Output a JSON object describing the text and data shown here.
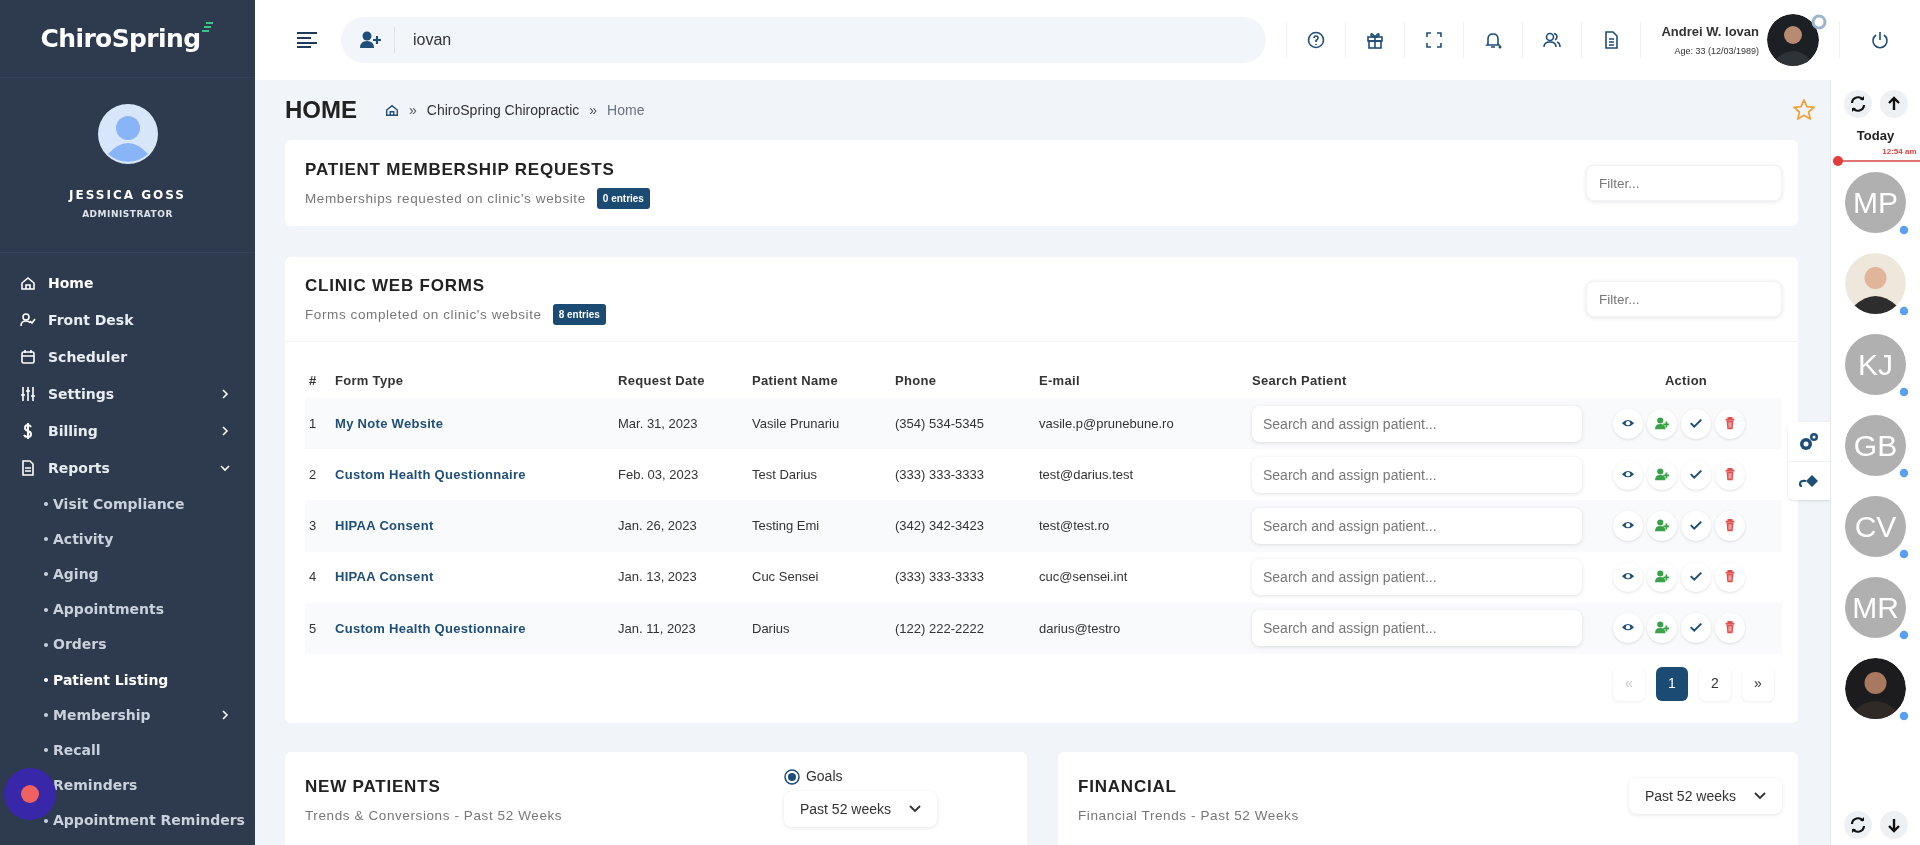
{
  "sidebar": {
    "logo": "ChiroSpring",
    "user": {
      "name": "JESSICA GOSS",
      "role": "ADMINISTRATOR"
    },
    "items": [
      {
        "label": "Home",
        "selected": true
      },
      {
        "label": "Front Desk",
        "selected": false
      },
      {
        "label": "Scheduler",
        "selected": false
      },
      {
        "label": "Settings",
        "selected": false,
        "expanded": false
      },
      {
        "label": "Billing",
        "selected": false,
        "expanded": false
      },
      {
        "label": "Reports",
        "selected": false,
        "expanded": true,
        "children": [
          {
            "label": "Visit Compliance",
            "selected": false
          },
          {
            "label": "Activity",
            "selected": false
          },
          {
            "label": "Aging",
            "selected": false
          },
          {
            "label": "Appointments",
            "selected": false
          },
          {
            "label": "Orders",
            "selected": false
          },
          {
            "label": "Patient Listing",
            "selected": true
          },
          {
            "label": "Membership",
            "selected": false,
            "expanded": false
          },
          {
            "label": "Recall",
            "selected": false
          },
          {
            "label": "Reminders",
            "selected": false
          },
          {
            "label": "Appointment Reminders",
            "selected": false
          }
        ]
      }
    ]
  },
  "topbar": {
    "search": {
      "value": "iovan"
    },
    "user": {
      "name": "Andrei W. Iovan",
      "age": "Age: 33 (12/03/1989)"
    }
  },
  "page": {
    "title": "HOME",
    "breadcrumb": [
      {
        "separator": "»",
        "label": "ChiroSpring Chiropractic"
      },
      {
        "separator": "»",
        "label": "Home"
      }
    ],
    "favorite": false
  },
  "membership_requests": {
    "title": "PATIENT MEMBERSHIP REQUESTS",
    "subtitle": "Memberships requested on clinic's website",
    "badge": "0 entries",
    "filter": {
      "placeholder": "Filter..."
    }
  },
  "web_forms": {
    "title": "CLINIC WEB FORMS",
    "subtitle": "Forms completed on clinic's website",
    "badge": "8 entries",
    "filter": {
      "placeholder": "Filter..."
    },
    "table": {
      "columns": [
        "#",
        "Form Type",
        "Request Date",
        "Patient Name",
        "Phone",
        "E-mail",
        "Search Patient",
        "Action"
      ],
      "rows": [
        {
          "num": "1",
          "form_type": "My Note Website",
          "date": "Mar. 31, 2023",
          "patient": "Vasile Prunariu",
          "phone": "(354) 534-5345",
          "email": "vasile.p@prunebune.ro",
          "search_placeholder": "Search and assign patient..."
        },
        {
          "num": "2",
          "form_type": "Custom Health Questionnaire",
          "date": "Feb. 03, 2023",
          "patient": "Test Darius",
          "phone": "(333) 333-3333",
          "email": "test@darius.test",
          "search_placeholder": "Search and assign patient..."
        },
        {
          "num": "3",
          "form_type": "HIPAA Consent",
          "date": "Jan. 26, 2023",
          "patient": "Testing Emi",
          "phone": "(342) 342-3423",
          "email": "test@test.ro",
          "search_placeholder": "Search and assign patient..."
        },
        {
          "num": "4",
          "form_type": "HIPAA Consent",
          "date": "Jan. 13, 2023",
          "patient": "Cuc Sensei",
          "phone": "(333) 333-3333",
          "email": "cuc@sensei.int",
          "search_placeholder": "Search and assign patient..."
        },
        {
          "num": "5",
          "form_type": "Custom Health Questionnaire",
          "date": "Jan. 11, 2023",
          "patient": "Darius",
          "phone": "(122) 222-2222",
          "email": "darius@testro",
          "search_placeholder": "Search and assign patient..."
        }
      ]
    },
    "pagination": [
      {
        "label": "«",
        "selected": false,
        "disabled": true
      },
      {
        "label": "1",
        "selected": true,
        "disabled": false
      },
      {
        "label": "2",
        "selected": false,
        "disabled": false
      },
      {
        "label": "»",
        "selected": false,
        "disabled": false
      }
    ]
  },
  "new_patients": {
    "title": "NEW PATIENTS",
    "subtitle": "Trends & Conversions - Past 52 Weeks",
    "goals": {
      "label": "Goals",
      "checked": true
    },
    "period": "Past 52 weeks"
  },
  "financial": {
    "title": "FINANCIAL",
    "subtitle": "Financial Trends - Past 52 Weeks",
    "period": "Past 52 weeks"
  },
  "right_panel": {
    "day": "Today",
    "time": "12:54 am",
    "people": [
      {
        "kind": "initials",
        "initials": "MP"
      },
      {
        "kind": "picture"
      },
      {
        "kind": "initials",
        "initials": "KJ"
      },
      {
        "kind": "initials",
        "initials": "GB"
      },
      {
        "kind": "initials",
        "initials": "CV"
      },
      {
        "kind": "initials",
        "initials": "MR"
      },
      {
        "kind": "picture"
      }
    ]
  }
}
